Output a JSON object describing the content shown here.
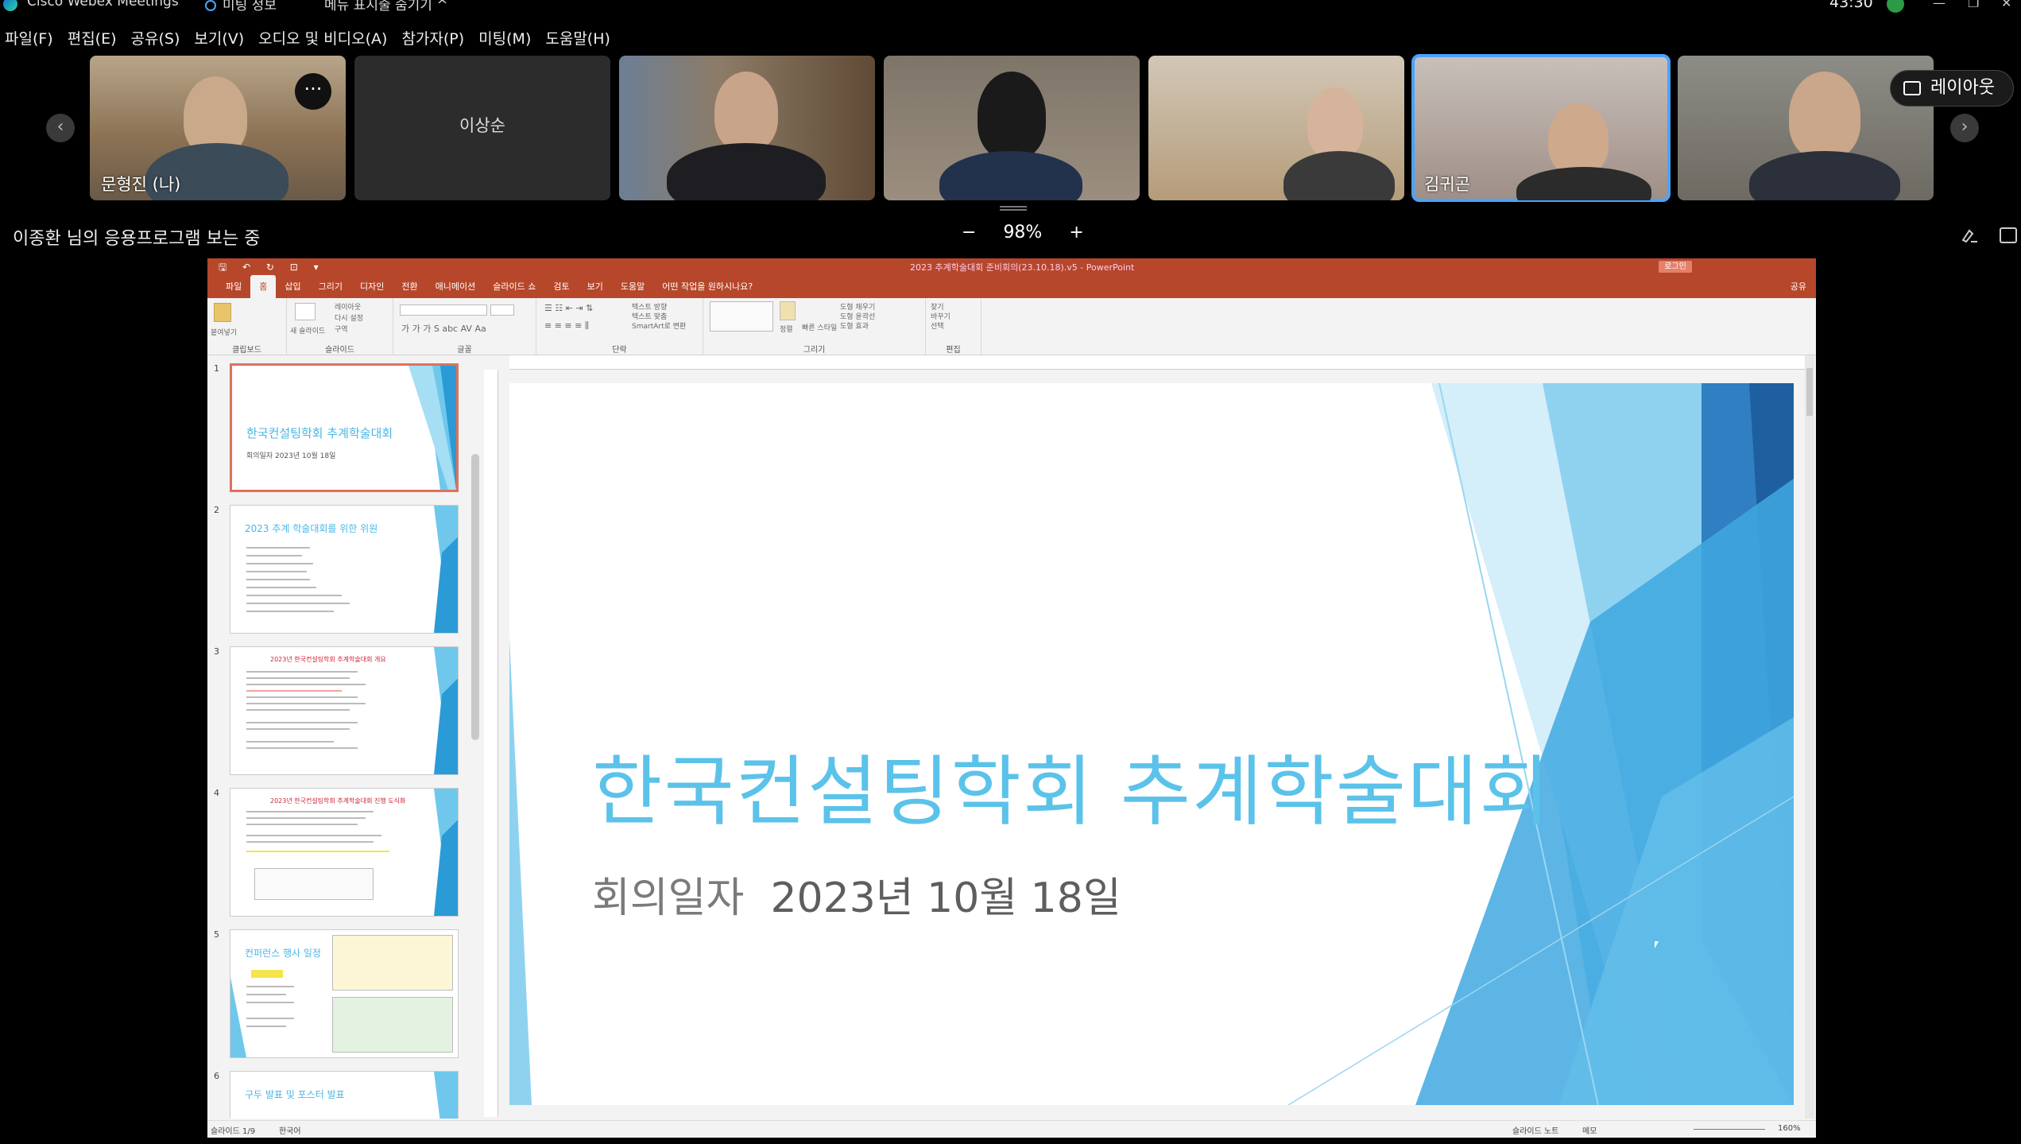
{
  "titlebar": {
    "app_title": "Cisco Webex Meetings",
    "meeting_info": "미팅 정보",
    "hide_menu": "메뉴 표시줄 숨기기 ^",
    "clock": "43:30"
  },
  "menubar": [
    "파일(F)",
    "편집(E)",
    "공유(S)",
    "보기(V)",
    "오디오 및 비디오(A)",
    "참가자(P)",
    "미팅(M)",
    "도움말(H)"
  ],
  "participants": [
    {
      "name": "문형진 (나)",
      "more": "···"
    },
    {
      "name": "이상순"
    },
    {
      "name": ""
    },
    {
      "name": ""
    },
    {
      "name": ""
    },
    {
      "name": "김귀곤"
    },
    {
      "name": ""
    }
  ],
  "layout_button": "레이아웃",
  "share": {
    "viewing_text": "이종환 님의 응용프로그램 보는 중",
    "zoom_minus": "−",
    "zoom_value": "98%",
    "zoom_plus": "+"
  },
  "powerpoint": {
    "doc_title": "2023 추계학술대회 준비회의(23.10.18).v5  -  PowerPoint",
    "signin": "로그인",
    "quick_access": "🖫 ↶ ↻ ⊡ ▾",
    "tabs": [
      "파일",
      "홈",
      "삽입",
      "그리기",
      "디자인",
      "전환",
      "애니메이션",
      "슬라이드 쇼",
      "검토",
      "보기",
      "도움말",
      "어떤 작업을 원하시나요?"
    ],
    "share_label": "공유",
    "ribbon_groups": [
      "클립보드",
      "슬라이드",
      "글꼴",
      "단락",
      "그리기",
      "편집"
    ],
    "ribbon_items": {
      "paste": "붙여넣기",
      "new_slide": "새 슬라이드",
      "layout": "레이아웃",
      "reset": "다시 설정",
      "section": "구역",
      "text_direction": "텍스트 방향",
      "align_text": "텍스트 맞춤",
      "smartart": "SmartArt로 변환",
      "arrange": "정렬",
      "quick_styles": "빠른 스타일",
      "shape_fill": "도형 채우기",
      "shape_outline": "도형 윤곽선",
      "shape_effects": "도형 효과",
      "find": "찾기",
      "replace": "바꾸기",
      "select": "선택"
    },
    "thumbnails": [
      {
        "num": "1",
        "title": "한국컨설팅학회 추계학술대회",
        "sub": "회의일자  2023년 10월 18일"
      },
      {
        "num": "2",
        "title": "2023 추계 학술대회를 위한 위원"
      },
      {
        "num": "3",
        "title": "2023년 한국컨설팅학회 추계학술대회 개요"
      },
      {
        "num": "4",
        "title": "2023년 한국컨설팅학회 추계학술대회 진행 도식화"
      },
      {
        "num": "5",
        "title": "컨퍼런스 행사 일정"
      },
      {
        "num": "6",
        "title": "구두 발표 및 포스터 발표"
      }
    ],
    "slide": {
      "title": "한국컨설팅학회 추계학술대회",
      "date_label": "회의일자",
      "date_value": "2023년 10월 18일"
    },
    "status": {
      "slide_count": "슬라이드 1/9",
      "language": "한국어",
      "notes": "슬라이드 노트",
      "memo": "메모",
      "zoom": "160%"
    }
  },
  "colors": {
    "ppt_accent": "#b7472a",
    "slide_title": "#5bc2ea",
    "active_tile_border": "#4aa3ff"
  }
}
